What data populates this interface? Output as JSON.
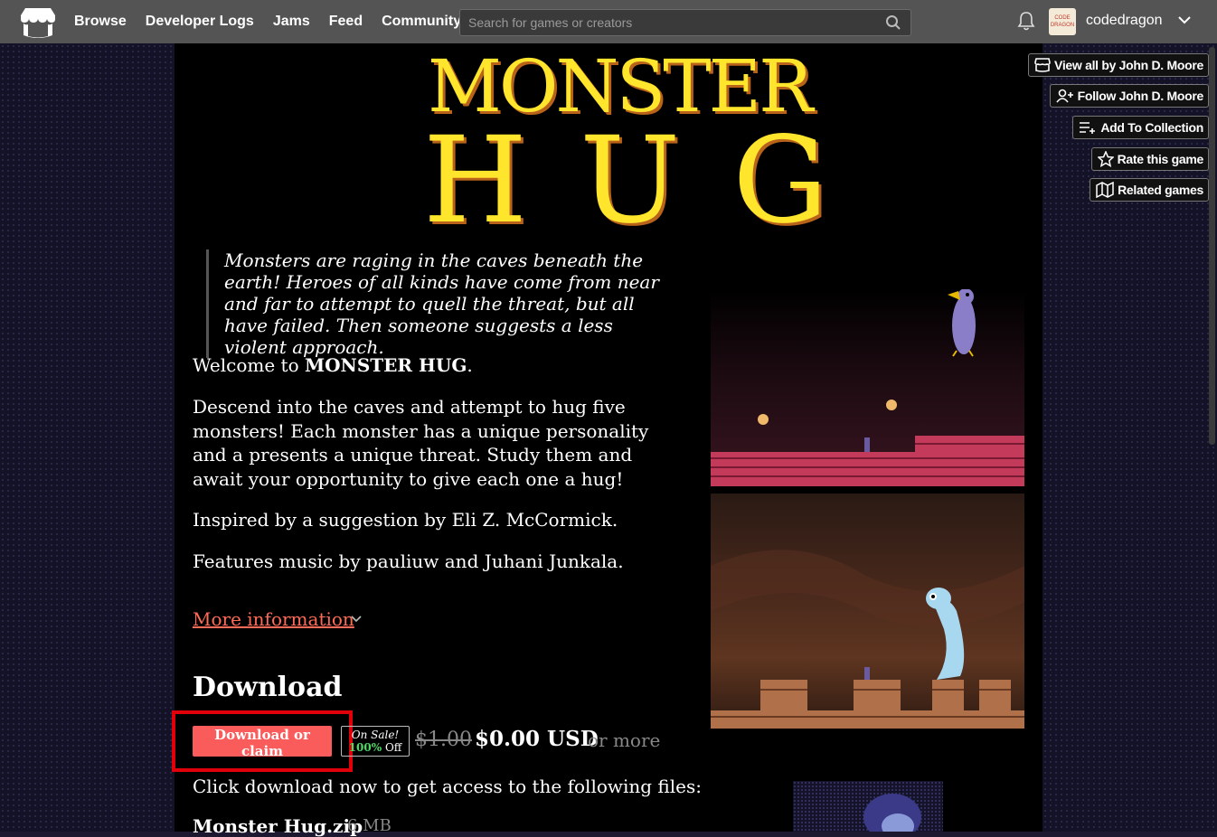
{
  "nav": {
    "items": [
      "Browse",
      "Developer Logs",
      "Jams",
      "Feed",
      "Community"
    ],
    "search_placeholder": "Search for games or creators",
    "avatar_text": "CODE DRAGON",
    "username": "codedragon"
  },
  "game": {
    "title_line1": "MONSTER",
    "title_line2": "HUG",
    "quote": "Monsters are raging in the caves beneath the earth! Heroes of all kinds have come from near and far to attempt to quell the threat, but all have failed. Then someone suggests a less violent approach.",
    "welcome_prefix": "Welcome to ",
    "welcome_bold": "MONSTER HUG",
    "welcome_suffix": ".",
    "para1": "Descend into the caves and attempt to hug five monsters! Each monster has a unique personality and a presents a unique threat. Study them and await your opportunity to give each one a hug!",
    "para2": "Inspired by a suggestion by Eli Z. McCormick.",
    "para3": "Features music by pauliuw and Juhani Junkala.",
    "more_info": "More information"
  },
  "download": {
    "heading": "Download",
    "button": "Download or claim",
    "sale_line1": "On Sale!",
    "sale_pct": "100%",
    "sale_off": " Off",
    "old_price": "$1.00",
    "new_price": "$0.00 USD",
    "or_more": "or more",
    "click_text": "Click download now to get access to the following files:",
    "file_name": "Monster Hug.zip",
    "file_size": "6 MB"
  },
  "actions": {
    "view_all": "View all by John D. Moore",
    "follow": "Follow John D. Moore",
    "collection": "Add To Collection",
    "rate": "Rate this game",
    "related": "Related games"
  },
  "colors": {
    "accent": "#fa5c5c",
    "title_yellow": "#ffe52b",
    "link": "#ff6b57",
    "highlight": "#e0000a"
  }
}
